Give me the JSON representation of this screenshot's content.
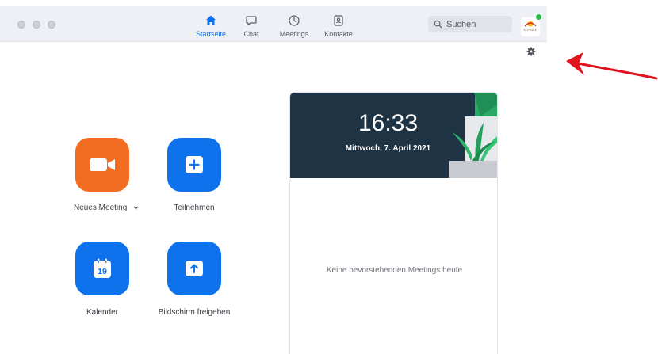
{
  "window": {
    "controls": [
      "close",
      "minimize",
      "maximize"
    ]
  },
  "nav": {
    "items": [
      {
        "label": "Startseite",
        "icon": "home-icon",
        "active": true
      },
      {
        "label": "Chat",
        "icon": "chat-icon",
        "active": false
      },
      {
        "label": "Meetings",
        "icon": "clock-icon",
        "active": false
      },
      {
        "label": "Kontakte",
        "icon": "contacts-icon",
        "active": false
      }
    ]
  },
  "search": {
    "placeholder": "Suchen",
    "icon": "search-icon"
  },
  "profile": {
    "avatar_text": "SCHULE",
    "status": "online"
  },
  "settings": {
    "icon": "gear-icon"
  },
  "actions": [
    {
      "label": "Neues Meeting",
      "icon": "video-camera-icon",
      "color": "#f26d21",
      "has_dropdown": true
    },
    {
      "label": "Teilnehmen",
      "icon": "plus-icon",
      "color": "#0e72ed",
      "has_dropdown": false
    },
    {
      "label": "Kalender",
      "icon": "calendar-icon",
      "calendar_day": "19",
      "color": "#0e72ed",
      "has_dropdown": false
    },
    {
      "label": "Bildschirm freigeben",
      "icon": "share-screen-icon",
      "color": "#0e72ed",
      "has_dropdown": false
    }
  ],
  "calendar_panel": {
    "time": "16:33",
    "date": "Mittwoch, 7. April 2021",
    "empty_message": "Keine bevorstehenden Meetings heute"
  },
  "colors": {
    "accent": "#0e72ed",
    "new_meeting": "#f26d21",
    "banner": "#1e3344",
    "status_online": "#2dbd4d",
    "annotation_arrow": "#e0141e"
  }
}
